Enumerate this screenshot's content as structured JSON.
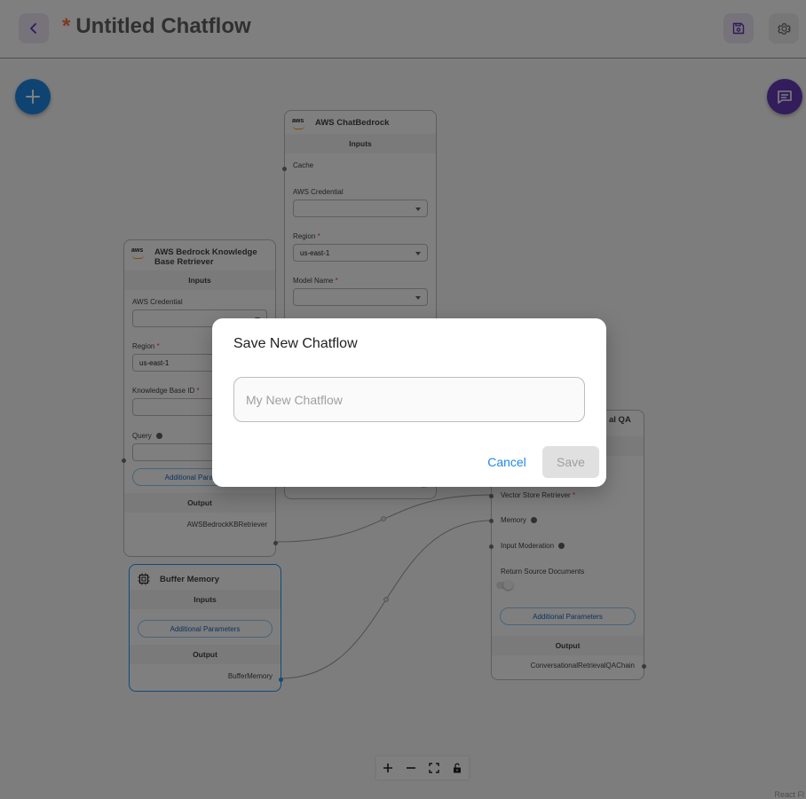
{
  "header": {
    "title_marker": "*",
    "title": "Untitled Chatflow"
  },
  "nodes": {
    "chatbedrock": {
      "title": "AWS ChatBedrock",
      "inputs_label": "Inputs",
      "cache_label": "Cache",
      "credential_label": "AWS Credential",
      "region_label": "Region",
      "region_value": "us-east-1",
      "model_label": "Model Name",
      "partial_output": "...",
      "required_mark": "*"
    },
    "kb_retriever": {
      "title": "AWS Bedrock Knowledge Base Retriever",
      "inputs_label": "Inputs",
      "credential_label": "AWS Credential",
      "region_label": "Region",
      "region_value": "us-east-1",
      "kb_id_label": "Knowledge Base ID",
      "query_label": "Query",
      "additional_label": "Additional Parameters",
      "output_section": "Output",
      "output_label": "AWSBedrockKBRetriever",
      "required_mark": "*"
    },
    "buffer_memory": {
      "title": "Buffer Memory",
      "inputs_label": "Inputs",
      "additional_label": "Additional Parameters",
      "output_section": "Output",
      "output_label": "BufferMemory"
    },
    "conv_qa": {
      "title_visible": "al QA",
      "vector_label": "Vector Store Retriever",
      "memory_label": "Memory",
      "moderation_label": "Input Moderation",
      "return_docs_label": "Return Source Documents",
      "return_docs_enabled": false,
      "additional_label": "Additional Parameters",
      "output_section": "Output",
      "output_label": "ConversationalRetrievalQAChain",
      "required_mark": "*"
    }
  },
  "attribution": "React Fl",
  "dialog": {
    "title": "Save New Chatflow",
    "input_value": "",
    "input_placeholder": "My New Chatflow",
    "cancel_label": "Cancel",
    "save_label": "Save"
  },
  "colors": {
    "accent_blue": "#1e88e5",
    "accent_purple": "#673ab7",
    "unsaved_marker": "#ff7043"
  }
}
